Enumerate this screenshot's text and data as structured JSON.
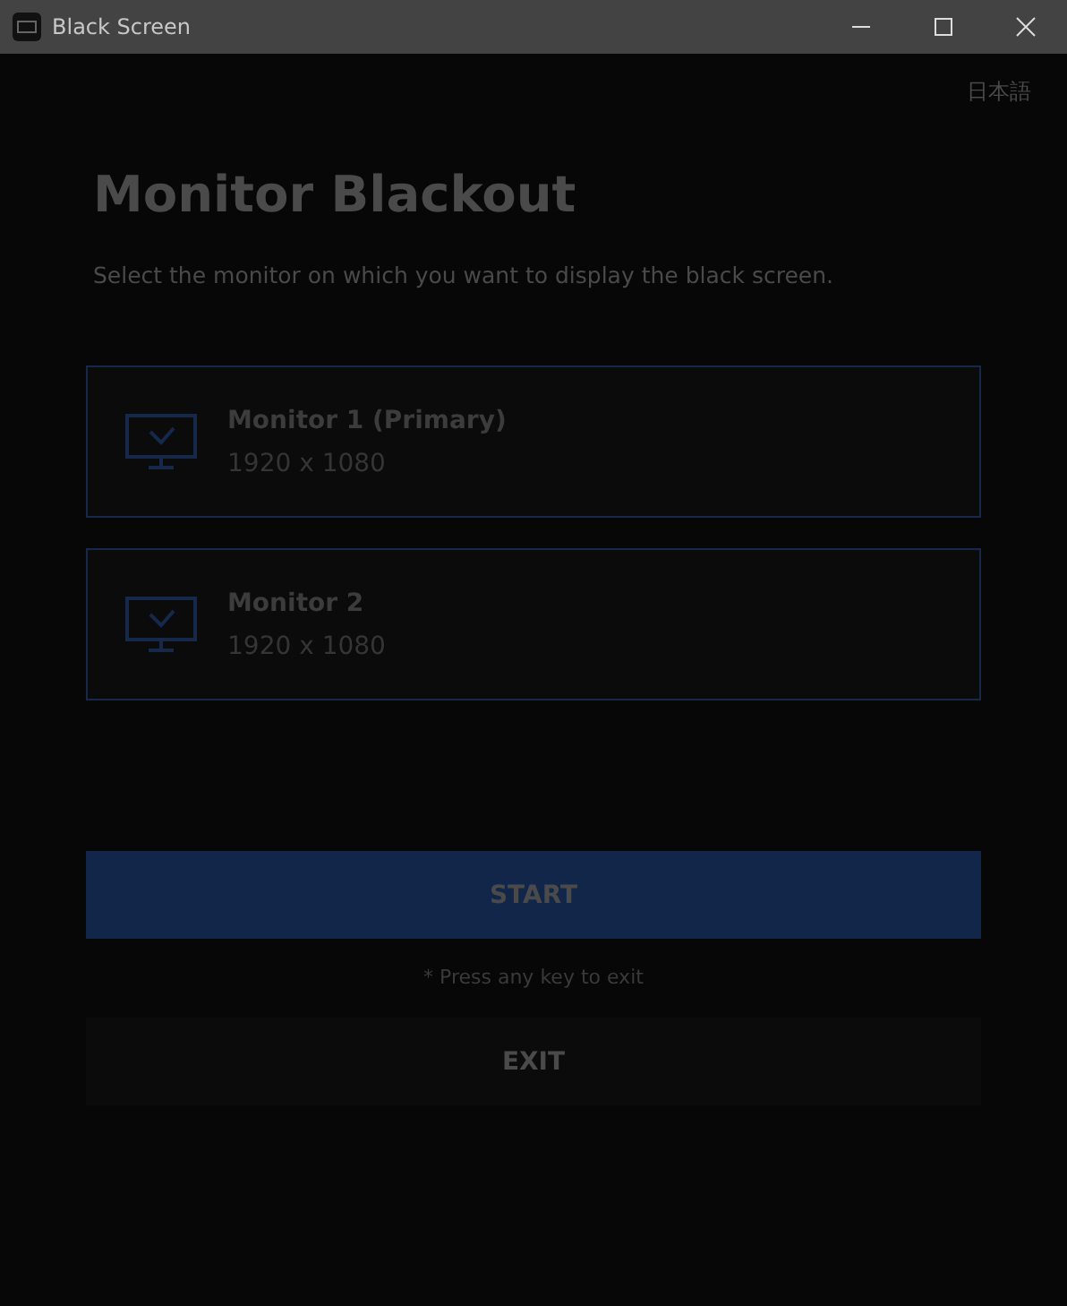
{
  "window": {
    "title": "Black Screen"
  },
  "language": "日本語",
  "heading": "Monitor Blackout",
  "subtitle": "Select the monitor on which you want to display the black screen.",
  "monitors": [
    {
      "name": "Monitor 1 (Primary)",
      "resolution": "1920 x 1080"
    },
    {
      "name": "Monitor 2",
      "resolution": "1920 x 1080"
    }
  ],
  "start_button": "START",
  "hint": "* Press any key to exit",
  "exit_button": "EXIT"
}
